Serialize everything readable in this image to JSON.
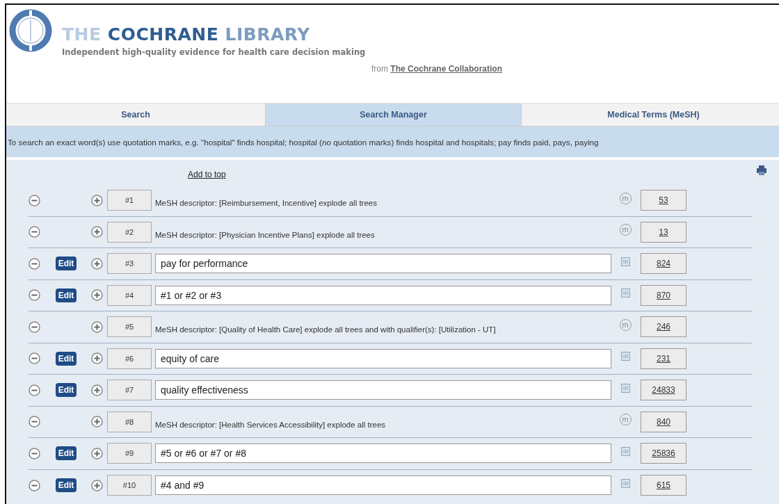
{
  "header": {
    "title_parts": [
      "THE",
      "COCHRANE",
      "LIBRARY"
    ],
    "tagline": "Independent high-quality evidence for health care decision making",
    "from_label": "from",
    "from_link": "The Cochrane Collaboration"
  },
  "tabs": [
    {
      "label": "Search",
      "selected": false
    },
    {
      "label": "Search Manager",
      "selected": true
    },
    {
      "label": "Medical Terms (MeSH)",
      "selected": false
    }
  ],
  "hint": "To search an exact word(s) use quotation marks, e.g. \"hospital\" finds hospital; hospital (no quotation marks) finds hospital and hospitals; pay finds paid, pays, paying",
  "add_to_top": "Add to top",
  "rows": [
    {
      "kind": "mesh",
      "number": "#1",
      "query": "MeSH descriptor: [Reimbursement, Incentive] explode all trees",
      "badge": "m",
      "count": "53"
    },
    {
      "kind": "mesh",
      "number": "#2",
      "query": "MeSH descriptor: [Physician Incentive Plans] explode all trees",
      "badge": "m",
      "count": "13"
    },
    {
      "kind": "text",
      "number": "#3",
      "edit": "Edit",
      "query": "pay for performance",
      "count": "824"
    },
    {
      "kind": "text",
      "number": "#4",
      "edit": "Edit",
      "query": "#1 or #2 or #3",
      "count": "870"
    },
    {
      "kind": "mesh",
      "number": "#5",
      "query": "MeSH descriptor: [Quality of Health Care] explode all trees and with qualifier(s): [Utilization - UT]",
      "badge": "m",
      "count": "246"
    },
    {
      "kind": "text",
      "number": "#6",
      "edit": "Edit",
      "query": "equity of care",
      "count": "231"
    },
    {
      "kind": "text",
      "number": "#7",
      "edit": "Edit",
      "query": "quality effectiveness",
      "count": "24833"
    },
    {
      "kind": "mesh",
      "number": "#8",
      "query": "MeSH descriptor: [Health Services Accessibility] explode all trees",
      "badge": "m",
      "count": "840"
    },
    {
      "kind": "text",
      "number": "#9",
      "edit": "Edit",
      "query": "#5 or #6 or #7 or #8",
      "count": "25836"
    },
    {
      "kind": "text",
      "number": "#10",
      "edit": "Edit",
      "query": "#4 and #9",
      "count": "615"
    }
  ]
}
